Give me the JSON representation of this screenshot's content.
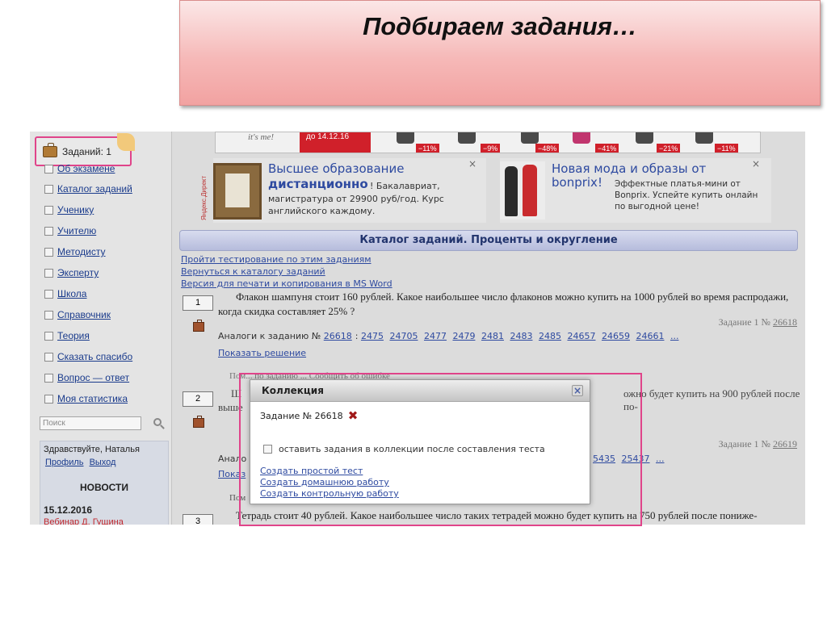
{
  "slide": {
    "title": "Подбираем  задания…"
  },
  "sidebar": {
    "tasks_badge": "Заданий: 1",
    "items": [
      {
        "label": "Об экзамене"
      },
      {
        "label": "Каталог заданий"
      },
      {
        "label": "Ученику"
      },
      {
        "label": "Учителю"
      },
      {
        "label": "Методисту"
      },
      {
        "label": "Эксперту"
      },
      {
        "label": "Школа"
      },
      {
        "label": "Справочник"
      },
      {
        "label": "Теория"
      },
      {
        "label": "Сказать спасибо"
      },
      {
        "label": "Вопрос — ответ"
      },
      {
        "label": "Моя статистика"
      }
    ],
    "search_placeholder": "Поиск",
    "greeting": "Здравствуйте, Наталья",
    "profile_link": "Профиль",
    "logout_link": "Выход",
    "news_title": "НОВОСТИ",
    "news_date": "15.12.2016",
    "news_item": "Вебинар Д. Гущина"
  },
  "ads": {
    "strip_itsme": "it's me!",
    "strip_red": "до 14.12.16",
    "discounts": [
      "−11%",
      "−9%",
      "−48%",
      "−41%",
      "−21%",
      "−11%"
    ],
    "yandex_label": "Яндекс.Директ",
    "ad1": {
      "headline": "Высшее образование",
      "headline_bold": "дистанционно",
      "headline_tail": "! Бакалавриат,",
      "body": "магистратура от 29900 руб/год. Курс",
      "body_bold": "английского каждому."
    },
    "ad2": {
      "headline": "Новая мода и образы от",
      "headline2": "bonprix!",
      "body": "Эффектные платья-мини от Bonprix. Успейте купить онлайн по выгодной цене!"
    },
    "close": "×"
  },
  "catalog": {
    "title": "Каталог заданий. Проценты и округление",
    "links": [
      "Пройти тестирование по этим заданиям",
      "Вернуться к каталогу заданий",
      "Версия для печати и копирования в MS Word"
    ]
  },
  "tasks": [
    {
      "num": "1",
      "text": "Флакон шампуня стоит 160 рублей. Какое наибольшее число флаконов можно купить на 1000 рублей во время распродажи, когда скидка составляет 25% ?",
      "ref_prefix": "Задание 1 №",
      "ref_id": "26618",
      "analogs_label": "Аналоги к заданию №",
      "analogs_main": "26618",
      "analogs": [
        "2475",
        "24705",
        "2477",
        "2479",
        "2481",
        "2483",
        "2485",
        "24657",
        "24659",
        "24661",
        "..."
      ],
      "show_solution": "Показать решение"
    },
    {
      "num": "2",
      "text_fragment": "Пом... по заданию ... Сообщить об ошибке",
      "text_left": "Ш",
      "text_left2": "выше",
      "text_right": "ожно будет купить на 900 рублей после по-",
      "ref_prefix": "Задание 1 №",
      "ref_id": "26619",
      "analogs_label": "Анало",
      "analogs_tail": [
        "5435",
        "25437",
        "..."
      ],
      "show_solution": "Показ"
    },
    {
      "num": "3",
      "text": "Тетрадь стоит 40 рублей. Какое наибольшее число таких тетрадей можно будет купить на 750 рублей после пониже-",
      "help": "Пом"
    }
  ],
  "modal": {
    "title": "Коллекция",
    "close": "×",
    "task_label": "Задание № 26618",
    "delete_icon": "✖",
    "checkbox_label": "оставить задания в коллекции после составления теста",
    "links": [
      "Создать простой тест",
      "Создать домашнюю работу",
      "Создать контрольную работу"
    ]
  }
}
